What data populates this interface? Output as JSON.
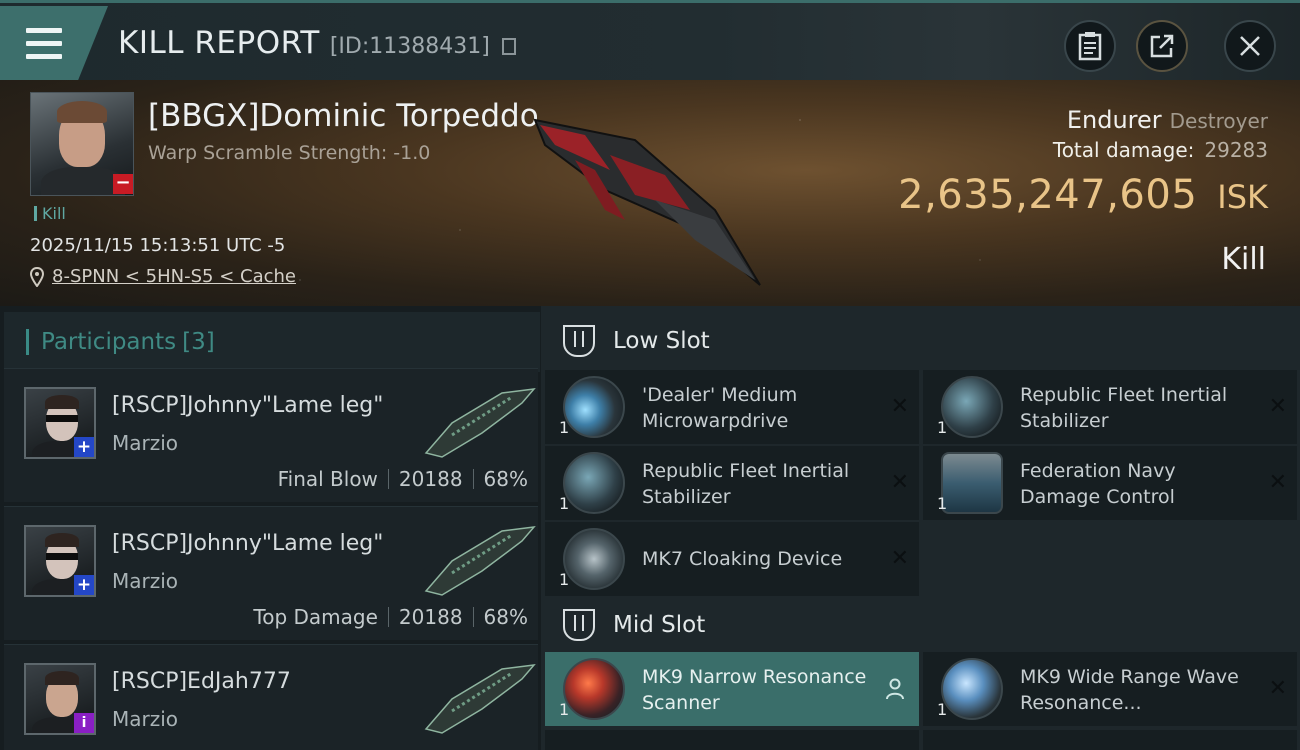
{
  "header": {
    "title": "KILL REPORT",
    "report_id": "[ID:11388431]",
    "icons": [
      "menu-icon",
      "copy-icon",
      "clipboard-icon",
      "share-icon",
      "close-icon"
    ],
    "accent_color": "#3d6f6c"
  },
  "victim": {
    "name": "[BBGX]Dominic Torpeddo",
    "warp_scramble": "Warp Scramble Strength: -1.0",
    "kill_tag": "Kill",
    "datetime": "2025/11/15 15:13:51 UTC -5",
    "location": "8-SPNN < 5HN-S5 < Cache",
    "ship_name": "Endurer",
    "ship_class": "Destroyer",
    "total_damage_label": "Total damage:",
    "total_damage": "29283",
    "isk_value": "2,635,247,605",
    "isk_unit": "ISK",
    "result": "Kill",
    "isk_color": "#e9c488"
  },
  "participants": {
    "label": "Participants",
    "count": "[3]",
    "rows": [
      {
        "name": "[RSCP]Johnny\"Lame leg\"",
        "corp": "Marzio",
        "role": "Final Blow",
        "damage": "20188",
        "percent": "68%",
        "badge": "+"
      },
      {
        "name": "[RSCP]Johnny\"Lame leg\"",
        "corp": "Marzio",
        "role": "Top Damage",
        "damage": "20188",
        "percent": "68%",
        "badge": "+"
      },
      {
        "name": "[RSCP]EdJah777",
        "corp": "Marzio",
        "badge": "i"
      }
    ]
  },
  "slots": {
    "low": {
      "label": "Low Slot",
      "modules": [
        {
          "name": "'Dealer' Medium Microwarpdrive",
          "qty": "1"
        },
        {
          "name": "Republic Fleet Inertial Stabilizer",
          "qty": "1"
        },
        {
          "name": "Republic Fleet Inertial Stabilizer",
          "qty": "1"
        },
        {
          "name": "Federation Navy Damage Control",
          "qty": "1"
        },
        {
          "name": "MK7 Cloaking Device",
          "qty": "1"
        }
      ]
    },
    "mid": {
      "label": "Mid Slot",
      "modules": [
        {
          "name": "MK9 Narrow Resonance Scanner",
          "qty": "1"
        },
        {
          "name": "MK9 Wide Range Wave Resonance...",
          "qty": "1"
        }
      ]
    }
  }
}
